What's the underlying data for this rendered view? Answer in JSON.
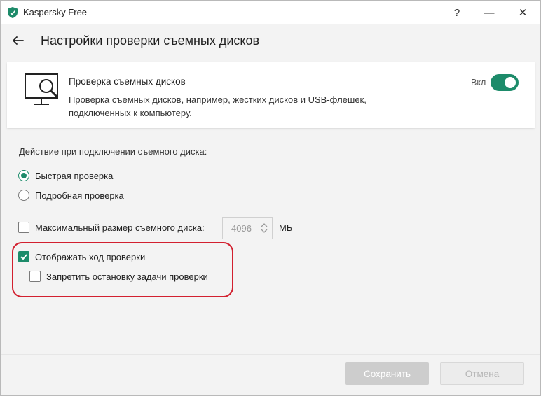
{
  "window": {
    "title": "Kaspersky Free",
    "help_glyph": "?",
    "minimize_glyph": "—",
    "close_glyph": "✕",
    "accent_color": "#1d8b6a",
    "highlight_color": "#d2202f"
  },
  "header": {
    "back_icon": "arrow-left-icon",
    "title": "Настройки проверки съемных дисков"
  },
  "card": {
    "icon": "monitor-search-icon",
    "title": "Проверка съемных дисков",
    "description": "Проверка съемных дисков, например, жестких дисков и USB-флешек, подключенных к компьютеру.",
    "toggle_label": "Вкл",
    "toggle_on": true
  },
  "settings": {
    "section_label": "Действие при подключении съемного диска:",
    "radio_options": [
      {
        "label": "Быстрая проверка",
        "checked": true
      },
      {
        "label": "Подробная проверка",
        "checked": false
      }
    ],
    "max_size": {
      "label": "Максимальный размер съемного диска:",
      "checked": false,
      "value": "4096",
      "unit": "МБ"
    },
    "show_progress": {
      "label": "Отображать ход проверки",
      "checked": true
    },
    "deny_stop": {
      "label": "Запретить остановку задачи проверки",
      "checked": false
    }
  },
  "footer": {
    "save_label": "Сохранить",
    "cancel_label": "Отмена"
  }
}
